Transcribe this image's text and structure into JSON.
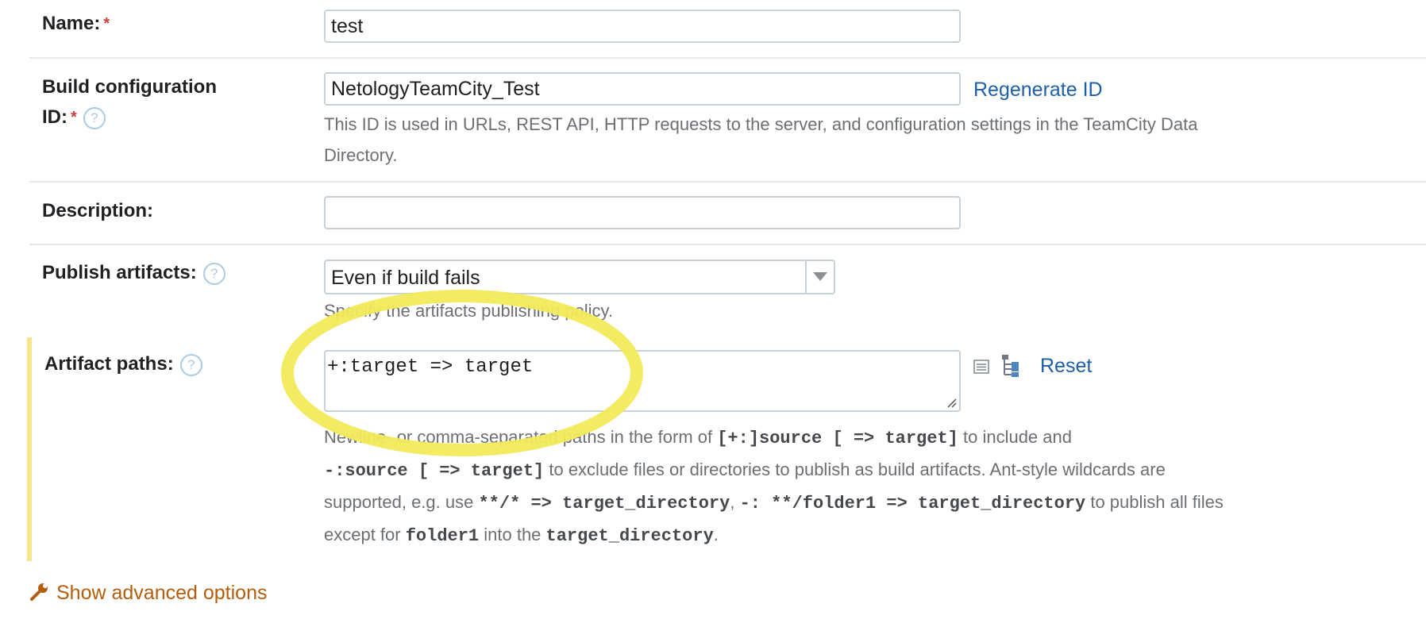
{
  "form": {
    "name": {
      "label": "Name:",
      "required": "*",
      "value": "test"
    },
    "build_id": {
      "label_line1": "Build configuration",
      "label_line2": "ID:",
      "required": "*",
      "value": "NetologyTeamCity_Test",
      "regenerate": "Regenerate ID",
      "note_line1": "This ID is used in URLs, REST API, HTTP requests to the server, and configuration settings in the TeamCity Data",
      "note_line2": "Directory."
    },
    "description": {
      "label": "Description:",
      "value": ""
    },
    "publish": {
      "label": "Publish artifacts:",
      "selected": "Even if build fails",
      "note": "Specify the artifacts publishing policy."
    },
    "artifact_paths": {
      "label": "Artifact paths:",
      "value": "+:target => target",
      "reset": "Reset",
      "note": {
        "t1": "Newline- or comma-separated paths in the form of ",
        "c1": "[+:]source [ => target]",
        "t2": " to include and",
        "c2": "-:source [ => target]",
        "t3": " to exclude files or directories to publish as build artifacts. Ant-style wildcards are",
        "t4": "supported, e.g. use ",
        "c3": "**/* => target_directory",
        "t5": ", ",
        "c4": "-: **/folder1 => target_directory",
        "t6": " to publish all files",
        "t7": "except for ",
        "c5": "folder1",
        "t8": " into the ",
        "c6": "target_directory",
        "t9": "."
      }
    },
    "advanced": "Show advanced options",
    "help_glyph": "?"
  },
  "colors": {
    "link": "#1d5fa8",
    "required": "#d33b3b",
    "highlight": "#f2ea5a",
    "advanced": "#b45d0c"
  },
  "icons": [
    "help-icon",
    "list-icon",
    "tree-icon",
    "dropdown-arrow-icon",
    "wrench-icon"
  ]
}
